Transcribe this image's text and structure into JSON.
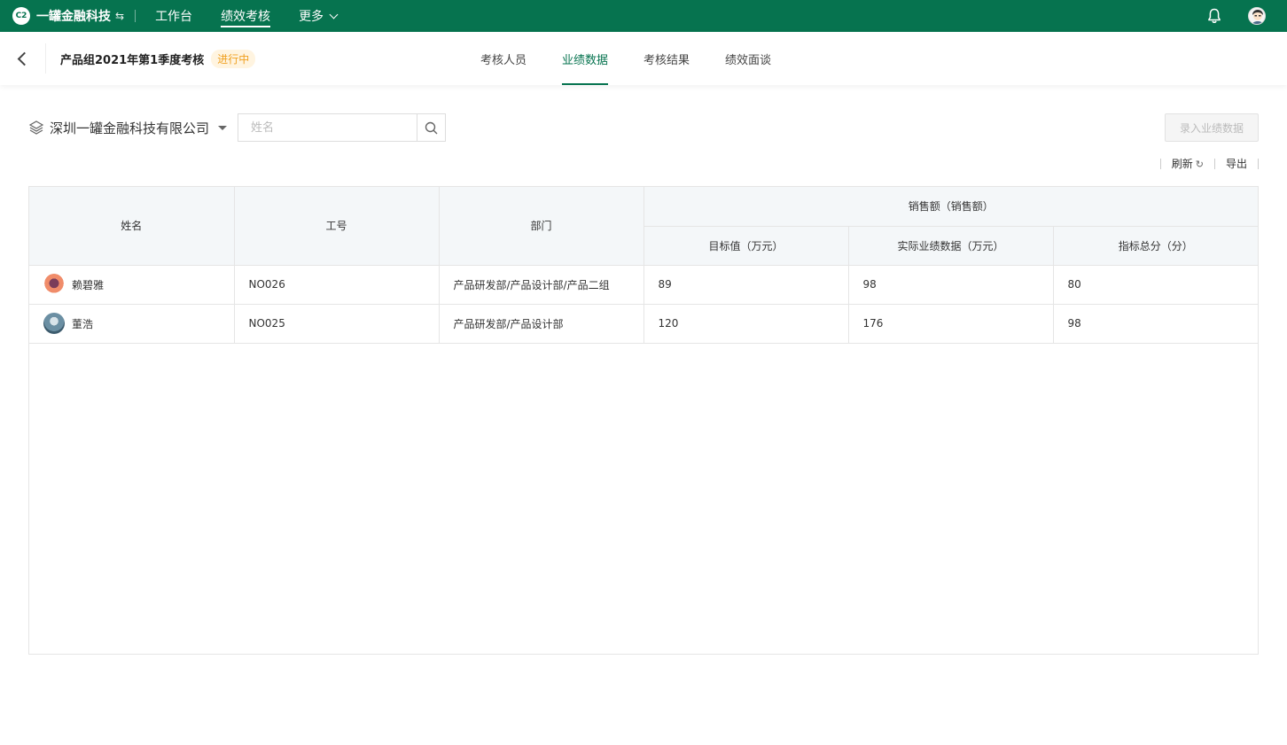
{
  "topbar": {
    "brand_logo": "C2",
    "brand_name": "一罐金融科技",
    "switch_icon": "switch-icon",
    "nav": [
      {
        "label": "工作台"
      },
      {
        "label": "绩效考核"
      },
      {
        "label": "更多"
      }
    ],
    "bell_icon": "bell-icon"
  },
  "subhead": {
    "title": "产品组2021年第1季度考核",
    "status": "进行中",
    "tabs": [
      {
        "label": "考核人员"
      },
      {
        "label": "业绩数据"
      },
      {
        "label": "考核结果"
      },
      {
        "label": "绩效面谈"
      }
    ]
  },
  "filter": {
    "company": "深圳一罐金融科技有限公司",
    "search_placeholder": "姓名",
    "record_button": "录入业绩数据"
  },
  "actions": {
    "refresh": "刷新",
    "export": "导出"
  },
  "table": {
    "headers": {
      "name": "姓名",
      "id": "工号",
      "dept": "部门",
      "group": "销售额（销售额）",
      "target": "目标值（万元）",
      "actual": "实际业绩数据（万元）",
      "score": "指标总分（分）"
    },
    "rows": [
      {
        "name": "赖碧雅",
        "id": "NO026",
        "dept": "产品研发部/产品设计部/产品二组",
        "target": "89",
        "actual": "98",
        "score": "80"
      },
      {
        "name": "董浩",
        "id": "NO025",
        "dept": "产品研发部/产品设计部",
        "target": "120",
        "actual": "176",
        "score": "98"
      }
    ]
  },
  "colors": {
    "brand": "#06734f",
    "status": "#f0a020"
  }
}
